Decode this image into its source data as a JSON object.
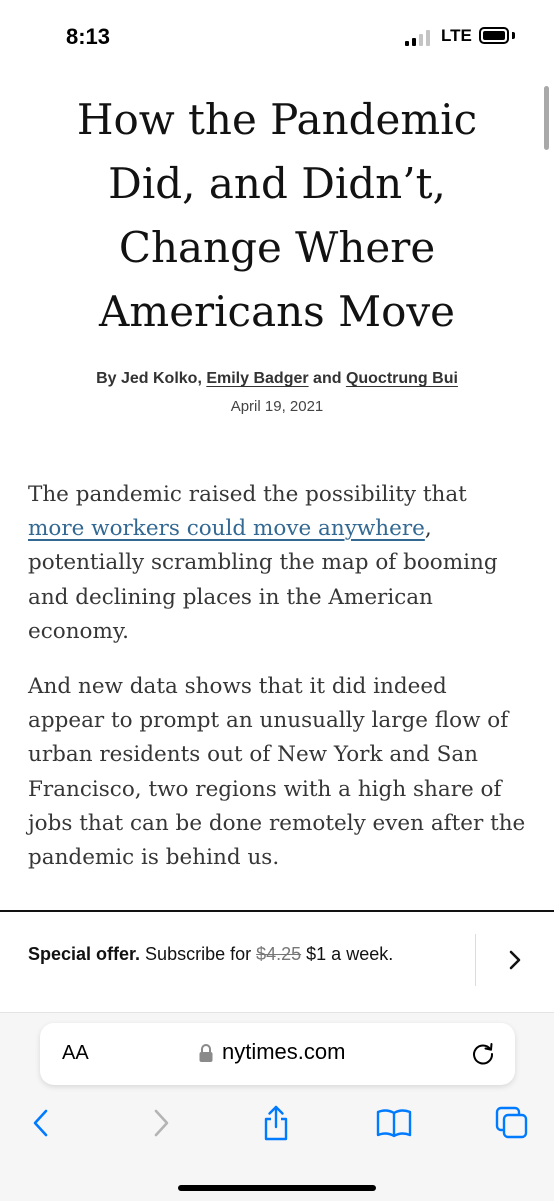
{
  "status_bar": {
    "time": "8:13",
    "network": "LTE",
    "battery_icon": "battery-full-icon",
    "signal_icon": "cellular-signal-icon"
  },
  "article": {
    "headline": "How the Pandemic Did, and Didn’t, Change Where Americans Move",
    "byline": {
      "prefix": "By Jed Kolko, ",
      "author_link_1": "Emily Badger",
      "connector": " and ",
      "author_link_2": "Quoctrung Bui"
    },
    "date": "April 19, 2021",
    "paragraphs": [
      {
        "before_link": "The pandemic raised the possibility that ",
        "link_text": "more workers could move anywhere",
        "after_link": ", potentially scrambling the map of booming and declining places in the American economy."
      },
      {
        "text": "And new data shows that it did indeed appear to prompt an unusually large flow of urban residents out of New York and San Francisco, two regions with a high share of jobs that can be done remotely even after the pandemic is behind us."
      }
    ]
  },
  "promo": {
    "label": "Special offer.",
    "text_before": " Subscribe for ",
    "old_price": "$4.25",
    "new_price": " $1 a week.",
    "arrow_icon": "chevron-right-icon"
  },
  "browser": {
    "text_size_label": "AA",
    "domain": "nytimes.com",
    "toolbar_icons": [
      "back-icon",
      "forward-icon",
      "share-icon",
      "bookmarks-icon",
      "tabs-icon"
    ],
    "accent_color": "#007aff"
  }
}
